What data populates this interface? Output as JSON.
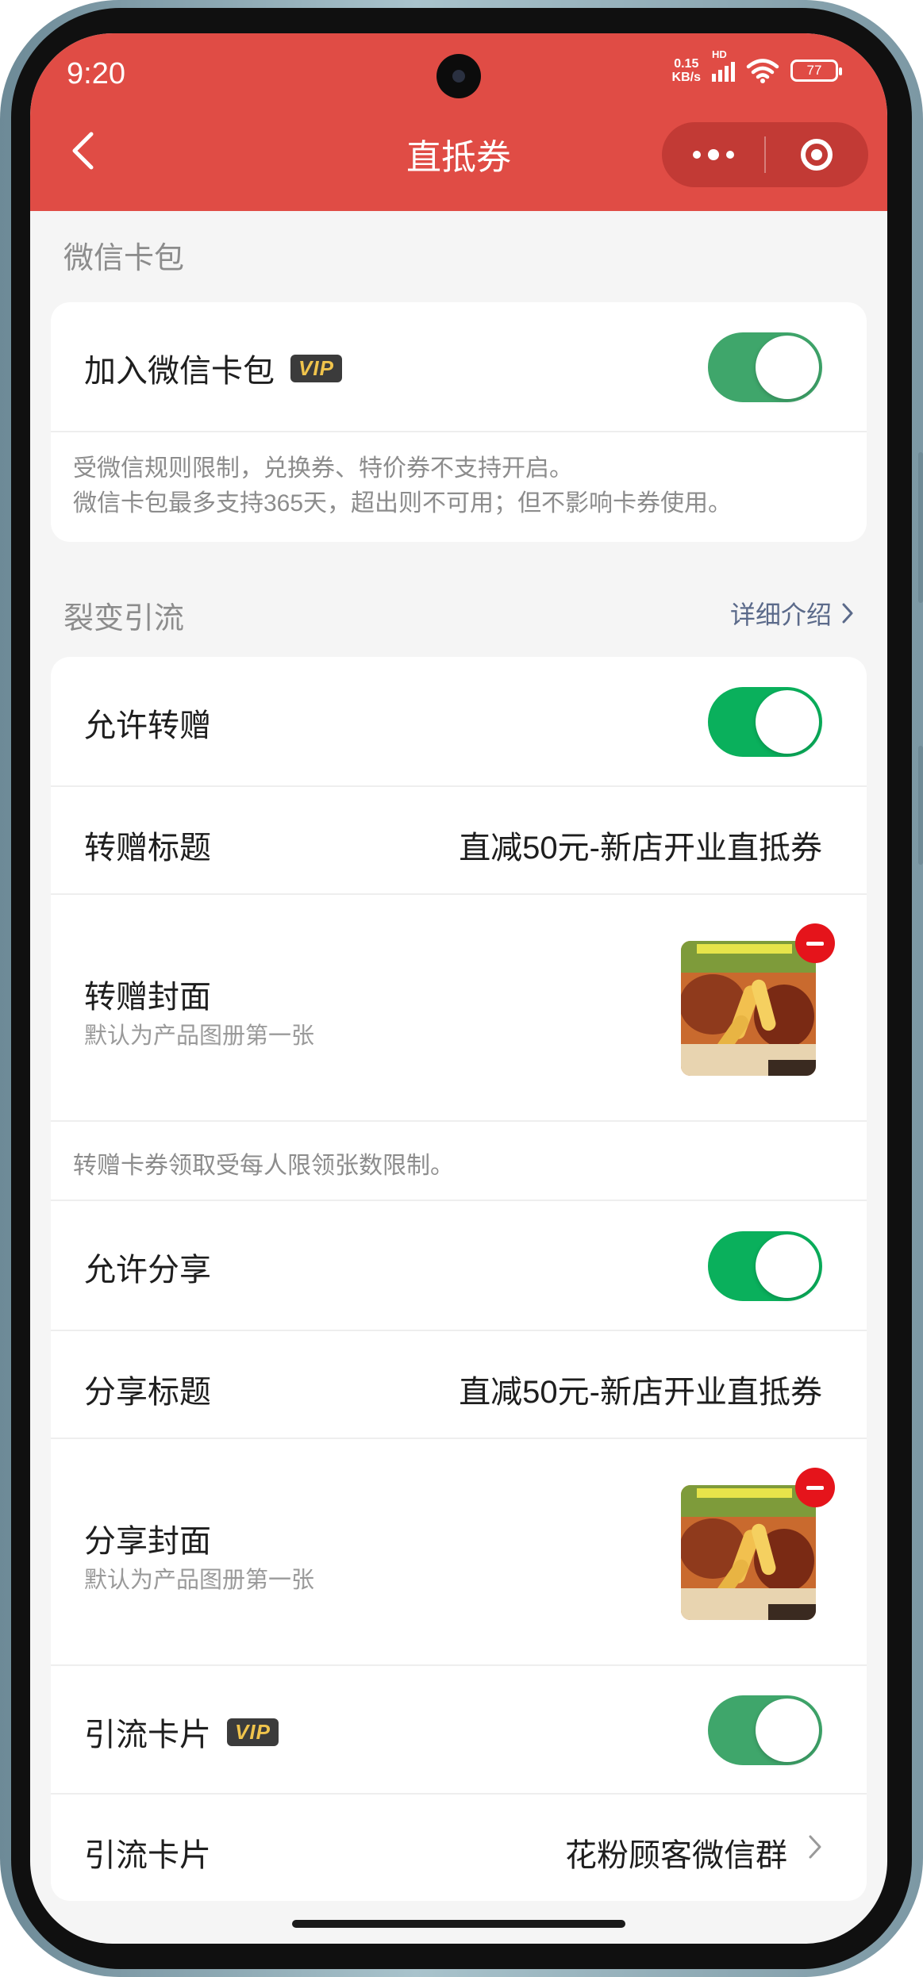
{
  "status_bar": {
    "time": "9:20",
    "net_speed_value": "0.15",
    "net_speed_unit": "KB/s",
    "network_tag": "HD",
    "battery": "77"
  },
  "header": {
    "title": "直抵券"
  },
  "wechat_card": {
    "section_title": "微信卡包",
    "add_label": "加入微信卡包",
    "vip_badge": "VIP",
    "add_enabled": true,
    "note_line1": "受微信规则限制，兑换券、特价券不支持开启。",
    "note_line2": "微信卡包最多支持365天，超出则不可用；但不影响卡券使用。"
  },
  "referral": {
    "section_title": "裂变引流",
    "detail_link": "详细介绍",
    "allow_gift_label": "允许转赠",
    "allow_gift_enabled": true,
    "gift_title_label": "转赠标题",
    "gift_title_value": "直减50元-新店开业直抵券",
    "gift_cover_label": "转赠封面",
    "gift_cover_sub": "默认为产品图册第一张",
    "gift_note": "转赠卡券领取受每人限领张数限制。",
    "allow_share_label": "允许分享",
    "allow_share_enabled": true,
    "share_title_label": "分享标题",
    "share_title_value": "直减50元-新店开业直抵券",
    "share_cover_label": "分享封面",
    "share_cover_sub": "默认为产品图册第一张",
    "lead_card_label": "引流卡片",
    "lead_card_vip": "VIP",
    "lead_card_enabled": true,
    "lead_card_select_label": "引流卡片",
    "lead_card_select_value": "花粉顾客微信群"
  },
  "colors": {
    "header": "#e04c45",
    "toggle_on": "#0ab05c",
    "background": "#f5f5f5",
    "remove_badge": "#e5141b"
  },
  "icons": [
    "back-icon",
    "more-dots-icon",
    "close-target-icon",
    "chevron-right-icon",
    "remove-icon"
  ]
}
